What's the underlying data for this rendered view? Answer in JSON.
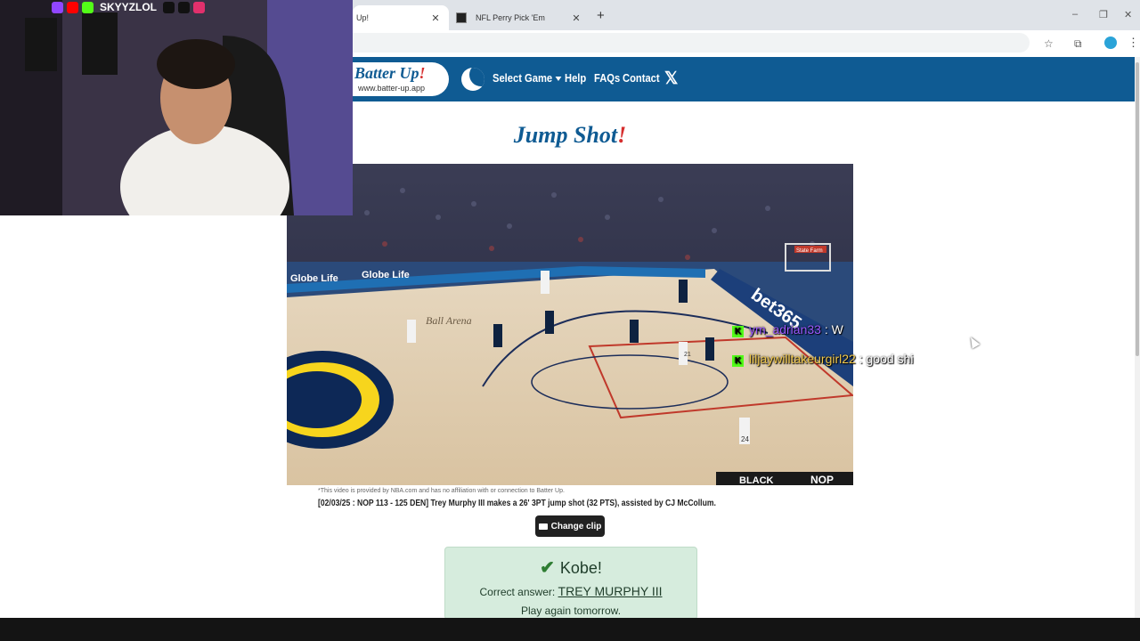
{
  "browser": {
    "tabs": [
      {
        "title": "Up!"
      },
      {
        "title": "NFL Perry Pick 'Em"
      }
    ],
    "new_tab": "+",
    "window_controls": {
      "minimize": "–",
      "restore": "❐",
      "close": "✕"
    }
  },
  "nav": {
    "logo_text": "Batter Up",
    "logo_bang": "!",
    "logo_url": "www.batter-up.app",
    "links": [
      "Select Game",
      "Help",
      "FAQs",
      "Contact"
    ],
    "x_label": "𝕏"
  },
  "page": {
    "title": "Jump Shot",
    "title_bang": "!",
    "disclaimer": "*This video is provided by NBA.com and has no affiliation with or connection to Batter Up.",
    "caption": "[02/03/25 : NOP 113 - 125 DEN] Trey Murphy III makes a 26' 3PT jump shot (32 PTS), assisted by CJ McCollum.",
    "change_clip": "Change clip",
    "video": {
      "court_ads": [
        "Globe Life",
        "Globe Life",
        "Ball Arena",
        "bet365",
        "State Farm"
      ],
      "jerseys": [
        "21",
        "24"
      ],
      "scorebug": [
        "BLACK",
        "NOP"
      ]
    },
    "result": {
      "heading": "Kobe!",
      "answer_label": "Correct answer:",
      "answer": "TREY MURPHY III",
      "footer": "Play again tomorrow."
    }
  },
  "overlay": {
    "handle": "SKYYZLOL",
    "chat": [
      {
        "user": "ym_adrian33",
        "message": "W",
        "color": "#9b59ff"
      },
      {
        "user": "liljaywilltakeurgirl22",
        "message": "good shi",
        "color": "#f2c94c"
      }
    ]
  },
  "colors": {
    "nav_bg": "#0f5b93",
    "brand_red": "#d62d2d",
    "result_bg": "#d6ecdd",
    "kick_green": "#53fc18"
  }
}
